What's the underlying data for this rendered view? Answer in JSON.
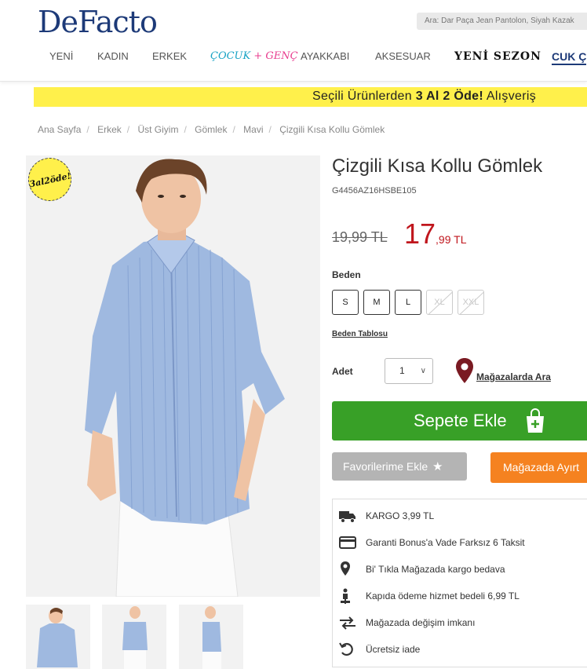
{
  "header": {
    "logo": "DeFacto",
    "search_placeholder": "Ara: Dar Paça Jean Pantolon, Siyah Kazak",
    "nav": {
      "yeni": "YENİ",
      "kadin": "KADIN",
      "erkek": "ERKEK",
      "cocuk": "ÇOCUK",
      "plus": "+",
      "genc": "GENÇ",
      "ayakkabi": "AYAKKABI",
      "aksesuar": "AKSESUAR",
      "yeni_sezon": "YENİ SEZON",
      "cuk": "CUK Ç"
    }
  },
  "promo": {
    "prefix": "Seçili Ürünlerden ",
    "highlight": "3 Al 2 Öde!",
    "suffix": "  Alışveriş"
  },
  "breadcrumb": [
    "Ana Sayfa",
    "Erkek",
    "Üst Giyim",
    "Gömlek",
    "Mavi",
    "Çizgili Kısa Kollu Gömlek"
  ],
  "badge": "3al2öde!",
  "product": {
    "title": "Çizgili Kısa Kollu Gömlek",
    "code": "G4456AZ16HSBE105",
    "old_price": "19,99 TL",
    "price_int": "17",
    "price_dec": ",99 TL",
    "size_label": "Beden",
    "sizes": [
      {
        "label": "S",
        "available": true
      },
      {
        "label": "M",
        "available": true
      },
      {
        "label": "L",
        "available": true
      },
      {
        "label": "XL",
        "available": false
      },
      {
        "label": "XXL",
        "available": false
      }
    ],
    "size_table": "Beden Tablosu",
    "qty_label": "Adet",
    "qty_value": "1",
    "store_search": "Mağazalarda Ara",
    "add_to_cart": "Sepete Ekle",
    "add_to_fav": "Favorilerime Ekle",
    "store_buy": "Mağazada Ayırt"
  },
  "features": [
    {
      "icon": "truck-icon",
      "text": "KARGO 3,99 TL"
    },
    {
      "icon": "credit-card-icon",
      "text": "Garanti Bonus'a Vade Farksız 6 Taksit"
    },
    {
      "icon": "location-pin-icon",
      "text": "Bi' Tıkla Mağazada kargo bedava"
    },
    {
      "icon": "delivery-person-icon",
      "text": "Kapıda ödeme hizmet bedeli 6,99 TL"
    },
    {
      "icon": "exchange-arrows-icon",
      "text": "Mağazada değişim imkanı"
    },
    {
      "icon": "return-icon",
      "text": "Ücretsiz iade"
    }
  ],
  "colors": {
    "brand_blue": "#1d3a78",
    "promo_yellow": "#fff04b",
    "price_red": "#c0161d",
    "cart_green": "#38a027",
    "store_orange": "#f58220"
  }
}
